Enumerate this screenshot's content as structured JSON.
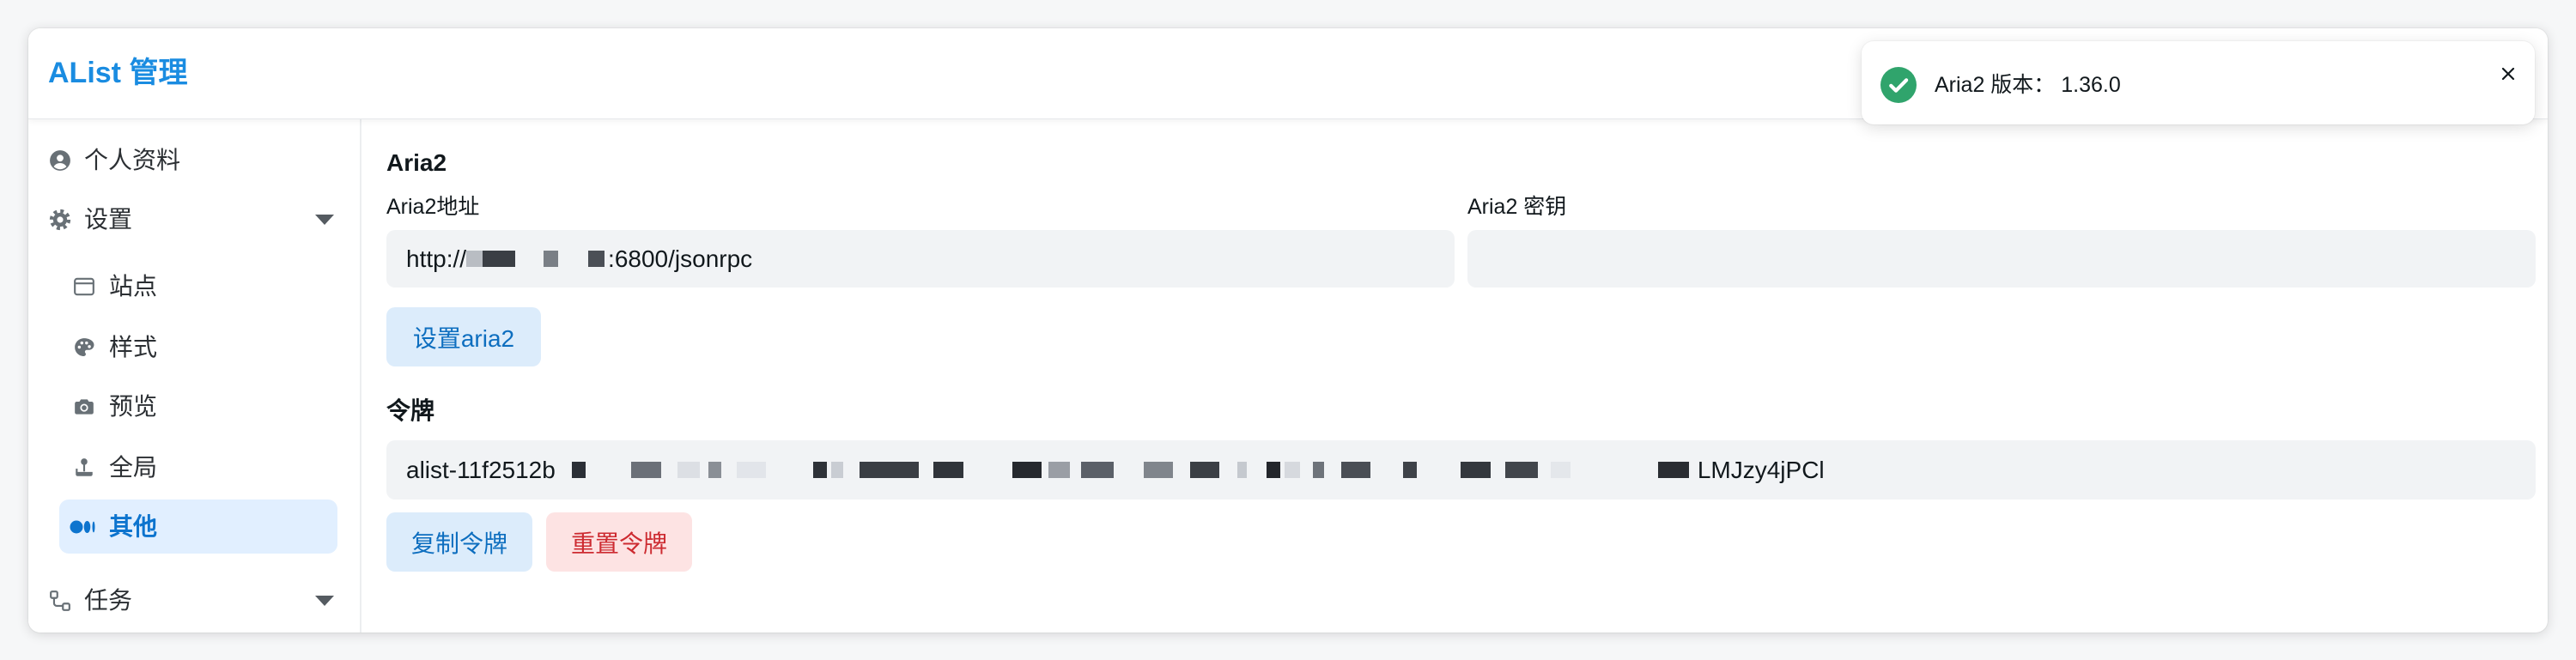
{
  "app": {
    "title": "AList 管理"
  },
  "toast": {
    "type": "success",
    "icon": "check-circle-icon",
    "message": "Aria2 版本： 1.36.0",
    "close_icon": "close-icon"
  },
  "sidebar": {
    "items": [
      {
        "label": "个人资料",
        "icon": "user-circle-icon"
      },
      {
        "label": "设置",
        "icon": "gear-icon",
        "expanded": true,
        "children": [
          {
            "label": "站点",
            "icon": "window-icon"
          },
          {
            "label": "样式",
            "icon": "palette-icon"
          },
          {
            "label": "预览",
            "icon": "camera-icon"
          },
          {
            "label": "全局",
            "icon": "joystick-icon"
          },
          {
            "label": "其他",
            "icon": "medium-logo-icon",
            "active": true
          }
        ]
      },
      {
        "label": "任务",
        "icon": "flow-icon",
        "expanded": false
      }
    ]
  },
  "main": {
    "aria2": {
      "heading": "Aria2",
      "address_label": "Aria2地址",
      "address_value_prefix": "http://",
      "address_value_suffix": ":6800/jsonrpc",
      "secret_label": "Aria2 密钥",
      "secret_value": "",
      "save_button": "设置aria2"
    },
    "token": {
      "heading": "令牌",
      "value_prefix": "alist-11f2512b",
      "value_suffix": "LMJzy4jPCl",
      "copy_button": "复制令牌",
      "reset_button": "重置令牌"
    }
  },
  "colors": {
    "primary": "#1a8ce1",
    "success": "#30a46c",
    "danger": "#cd2b31",
    "input_bg": "#f1f3f5",
    "active_bg": "#e1efff"
  }
}
